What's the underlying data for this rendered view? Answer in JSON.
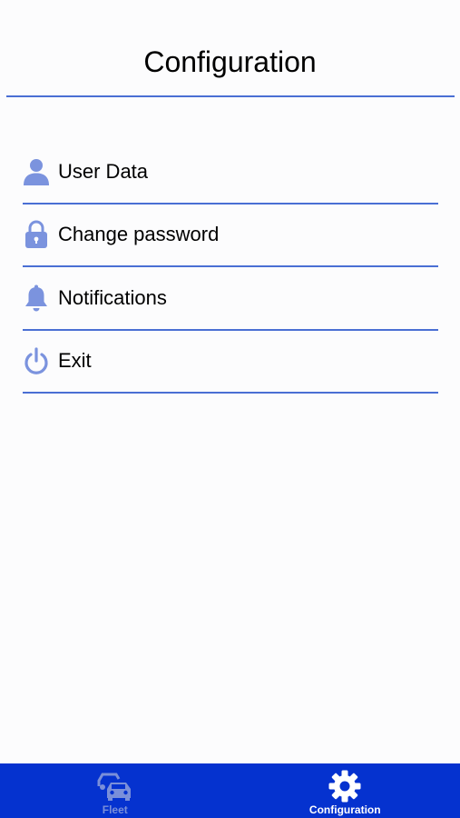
{
  "header": {
    "title": "Configuration"
  },
  "menu": {
    "items": [
      {
        "label": "User Data",
        "icon": "user-icon"
      },
      {
        "label": "Change password",
        "icon": "lock-icon"
      },
      {
        "label": "Notifications",
        "icon": "bell-icon"
      },
      {
        "label": "Exit",
        "icon": "power-icon"
      }
    ]
  },
  "tabbar": {
    "tabs": [
      {
        "label": "Fleet",
        "icon": "cars-icon",
        "active": false
      },
      {
        "label": "Configuration",
        "icon": "gear-icon",
        "active": true
      }
    ]
  },
  "colors": {
    "accent": "#4a6fd4",
    "icon": "#7b93de",
    "tabbar_bg": "#0532cf",
    "tab_inactive": "#7a8fd9",
    "tab_active": "#ffffff"
  }
}
